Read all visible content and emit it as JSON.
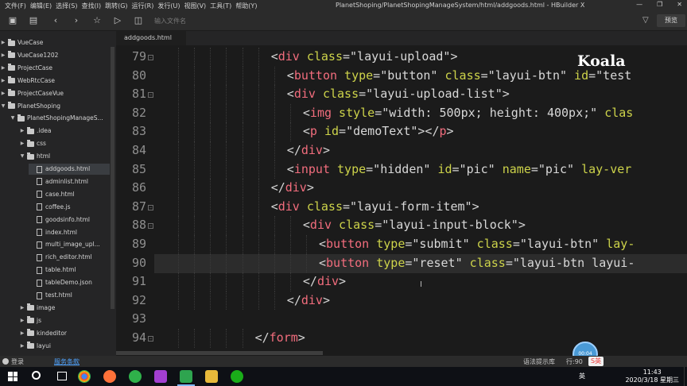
{
  "window": {
    "title": "PlanetShoping/PlanetShopingManageSystem/html/addgoods.html - HBuilder X",
    "menu": [
      "文件(F)",
      "编辑(E)",
      "选择(S)",
      "查找(I)",
      "跳转(G)",
      "运行(R)",
      "发行(U)",
      "视图(V)",
      "工具(T)",
      "帮助(Y)"
    ],
    "controls": [
      "—",
      "❐",
      "✕"
    ]
  },
  "toolbar": {
    "search_placeholder": "输入文件名",
    "preview_label": "预览",
    "icons": [
      "new-file-icon",
      "save-icon",
      "back-icon",
      "forward-icon",
      "star-icon",
      "run-icon",
      "open-file-icon"
    ]
  },
  "sidebar": {
    "items": [
      {
        "label": "VueCase",
        "kind": "folder",
        "depth": 0,
        "expanded": false
      },
      {
        "label": "VueCase1202",
        "kind": "folder",
        "depth": 0,
        "expanded": false
      },
      {
        "label": "ProjectCase",
        "kind": "folder",
        "depth": 0,
        "expanded": false
      },
      {
        "label": "WebRtcCase",
        "kind": "folder",
        "depth": 0,
        "expanded": false
      },
      {
        "label": "ProjectCaseVue",
        "kind": "folder",
        "depth": 0,
        "expanded": false
      },
      {
        "label": "PlanetShoping",
        "kind": "folder",
        "depth": 0,
        "expanded": true
      },
      {
        "label": "PlanetShopingManageS...",
        "kind": "folder",
        "depth": 1,
        "expanded": true
      },
      {
        "label": ".idea",
        "kind": "folder",
        "depth": 2,
        "expanded": false
      },
      {
        "label": "css",
        "kind": "folder",
        "depth": 2,
        "expanded": false
      },
      {
        "label": "html",
        "kind": "folder",
        "depth": 2,
        "expanded": true
      },
      {
        "label": "addgoods.html",
        "kind": "file",
        "depth": 3,
        "selected": true
      },
      {
        "label": "adminlist.html",
        "kind": "file",
        "depth": 3
      },
      {
        "label": "case.html",
        "kind": "file",
        "depth": 3
      },
      {
        "label": "coffee.js",
        "kind": "file",
        "depth": 3
      },
      {
        "label": "goodsinfo.html",
        "kind": "file",
        "depth": 3
      },
      {
        "label": "index.html",
        "kind": "file",
        "depth": 3
      },
      {
        "label": "multi_image_upl...",
        "kind": "file",
        "depth": 3
      },
      {
        "label": "rich_editor.html",
        "kind": "file",
        "depth": 3
      },
      {
        "label": "table.html",
        "kind": "file",
        "depth": 3
      },
      {
        "label": "tableDemo.json",
        "kind": "file",
        "depth": 3
      },
      {
        "label": "test.html",
        "kind": "file",
        "depth": 3
      },
      {
        "label": "image",
        "kind": "folder",
        "depth": 2,
        "expanded": false
      },
      {
        "label": "js",
        "kind": "folder",
        "depth": 2,
        "expanded": false
      },
      {
        "label": "kindeditor",
        "kind": "folder",
        "depth": 2,
        "expanded": false
      },
      {
        "label": "layui",
        "kind": "folder",
        "depth": 2,
        "expanded": false
      }
    ]
  },
  "editor": {
    "tab_label": "addgoods.html",
    "watermark": "Koala",
    "current_line": 90,
    "lines": [
      {
        "num": "79",
        "fold": true,
        "indent": 7,
        "segs": [
          [
            "p",
            "<"
          ],
          [
            "t",
            "div"
          ],
          [
            "a",
            " class"
          ],
          [
            "p",
            "="
          ],
          [
            "s",
            "\"layui-upload\""
          ],
          [
            "p",
            ">"
          ]
        ]
      },
      {
        "num": "80",
        "fold": false,
        "indent": 8,
        "segs": [
          [
            "p",
            "<"
          ],
          [
            "t",
            "button"
          ],
          [
            "a",
            " type"
          ],
          [
            "p",
            "="
          ],
          [
            "s",
            "\"button\""
          ],
          [
            "a",
            " class"
          ],
          [
            "p",
            "="
          ],
          [
            "s",
            "\"layui-btn\""
          ],
          [
            "a",
            " id"
          ],
          [
            "p",
            "="
          ],
          [
            "s",
            "\"test"
          ]
        ]
      },
      {
        "num": "81",
        "fold": true,
        "indent": 8,
        "segs": [
          [
            "p",
            "<"
          ],
          [
            "t",
            "div"
          ],
          [
            "a",
            " class"
          ],
          [
            "p",
            "="
          ],
          [
            "s",
            "\"layui-upload-list\""
          ],
          [
            "p",
            ">"
          ]
        ]
      },
      {
        "num": "82",
        "fold": false,
        "indent": 9,
        "segs": [
          [
            "p",
            "<"
          ],
          [
            "t",
            "img"
          ],
          [
            "a",
            " style"
          ],
          [
            "p",
            "="
          ],
          [
            "s",
            "\"width: 500px; height: 400px;\""
          ],
          [
            "a",
            " clas"
          ]
        ]
      },
      {
        "num": "83",
        "fold": false,
        "indent": 9,
        "segs": [
          [
            "p",
            "<"
          ],
          [
            "t",
            "p"
          ],
          [
            "a",
            " id"
          ],
          [
            "p",
            "="
          ],
          [
            "s",
            "\"demoText\""
          ],
          [
            "p",
            "></"
          ],
          [
            "t",
            "p"
          ],
          [
            "p",
            ">"
          ]
        ]
      },
      {
        "num": "84",
        "fold": false,
        "indent": 8,
        "segs": [
          [
            "p",
            "</"
          ],
          [
            "t",
            "div"
          ],
          [
            "p",
            ">"
          ]
        ]
      },
      {
        "num": "85",
        "fold": false,
        "indent": 8,
        "segs": [
          [
            "p",
            "<"
          ],
          [
            "t",
            "input"
          ],
          [
            "a",
            " type"
          ],
          [
            "p",
            "="
          ],
          [
            "s",
            "\"hidden\""
          ],
          [
            "a",
            " id"
          ],
          [
            "p",
            "="
          ],
          [
            "s",
            "\"pic\""
          ],
          [
            "a",
            " name"
          ],
          [
            "p",
            "="
          ],
          [
            "s",
            "\"pic\""
          ],
          [
            "a",
            " lay-ver"
          ]
        ]
      },
      {
        "num": "86",
        "fold": false,
        "indent": 7,
        "segs": [
          [
            "p",
            "</"
          ],
          [
            "t",
            "div"
          ],
          [
            "p",
            ">"
          ]
        ]
      },
      {
        "num": "87",
        "fold": true,
        "indent": 7,
        "segs": [
          [
            "p",
            "<"
          ],
          [
            "t",
            "div"
          ],
          [
            "a",
            " class"
          ],
          [
            "p",
            "="
          ],
          [
            "s",
            "\"layui-form-item\""
          ],
          [
            "p",
            ">"
          ]
        ]
      },
      {
        "num": "88",
        "fold": true,
        "indent": 9,
        "segs": [
          [
            "p",
            "<"
          ],
          [
            "t",
            "div"
          ],
          [
            "a",
            " class"
          ],
          [
            "p",
            "="
          ],
          [
            "s",
            "\"layui-input-block\""
          ],
          [
            "p",
            ">"
          ]
        ]
      },
      {
        "num": "89",
        "fold": false,
        "indent": 10,
        "segs": [
          [
            "p",
            "<"
          ],
          [
            "t",
            "button"
          ],
          [
            "a",
            " type"
          ],
          [
            "p",
            "="
          ],
          [
            "s",
            "\"submit\""
          ],
          [
            "a",
            " class"
          ],
          [
            "p",
            "="
          ],
          [
            "s",
            "\"layui-btn\""
          ],
          [
            "a",
            " lay-"
          ]
        ]
      },
      {
        "num": "90",
        "fold": false,
        "indent": 10,
        "segs": [
          [
            "p",
            "<"
          ],
          [
            "t",
            "button"
          ],
          [
            "a",
            " type"
          ],
          [
            "p",
            "="
          ],
          [
            "s",
            "\"reset\""
          ],
          [
            "a",
            " class"
          ],
          [
            "p",
            "="
          ],
          [
            "s",
            "\"layui-btn layui-"
          ]
        ]
      },
      {
        "num": "91",
        "fold": false,
        "indent": 9,
        "segs": [
          [
            "p",
            "</"
          ],
          [
            "t",
            "div"
          ],
          [
            "p",
            ">"
          ]
        ]
      },
      {
        "num": "92",
        "fold": false,
        "indent": 8,
        "segs": [
          [
            "p",
            "</"
          ],
          [
            "t",
            "div"
          ],
          [
            "p",
            ">"
          ]
        ]
      },
      {
        "num": "93",
        "fold": false,
        "indent": 0,
        "segs": []
      },
      {
        "num": "94",
        "fold": true,
        "indent": 6,
        "segs": [
          [
            "p",
            "</"
          ],
          [
            "t",
            "form"
          ],
          [
            "p",
            ">"
          ]
        ]
      }
    ]
  },
  "recorder_bubble": "00:04",
  "statusbar": {
    "login": "登录",
    "link": "服务条款",
    "message": "语法提示库",
    "position": "行:90",
    "ime": "S英"
  },
  "taskbar": {
    "time": "11:43",
    "date": "2020/3/18 星期三",
    "tray_lang": "英",
    "apps": [
      "chrome-icon",
      "firefox-icon",
      "360-browser-icon",
      "phpstorm-icon",
      "hbuilder-icon",
      "explorer-icon",
      "wechat-icon"
    ]
  },
  "colors": {
    "tag": "#f26d7d",
    "attr": "#cdd34a",
    "string": "#d8d8d8",
    "background": "#1b1b1b",
    "link": "#4fa3ff"
  }
}
